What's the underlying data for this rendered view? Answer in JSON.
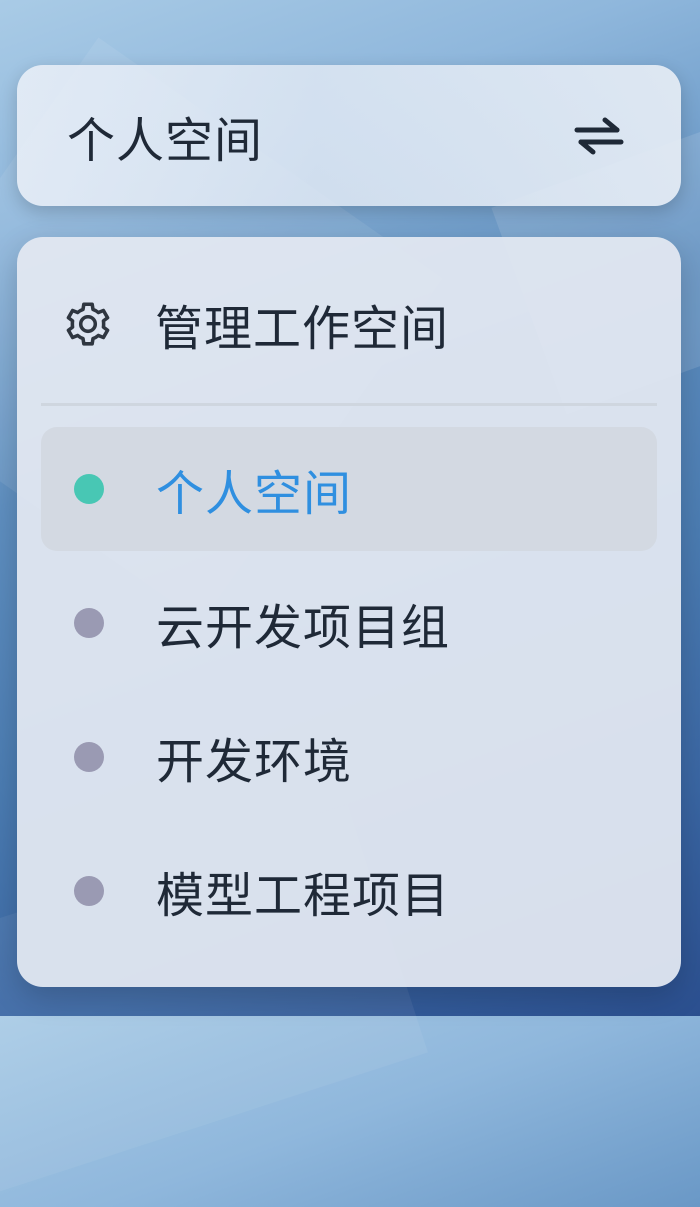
{
  "switcher": {
    "current_workspace": "个人空间",
    "swap_icon": "swap-arrows-icon"
  },
  "menu": {
    "manage": {
      "label": "管理工作空间",
      "icon": "gear-icon"
    },
    "workspaces": [
      {
        "label": "个人空间",
        "active": true,
        "dot_color": "#48c7b4"
      },
      {
        "label": "云开发项目组",
        "active": false,
        "dot_color": "#9a9ab3"
      },
      {
        "label": "开发环境",
        "active": false,
        "dot_color": "#9a9ab3"
      },
      {
        "label": "模型工程项目",
        "active": false,
        "dot_color": "#9a9ab3"
      }
    ]
  },
  "colors": {
    "active_text": "#2f8fe0",
    "text": "#1f2937",
    "active_bg": "#d3d9e2"
  }
}
